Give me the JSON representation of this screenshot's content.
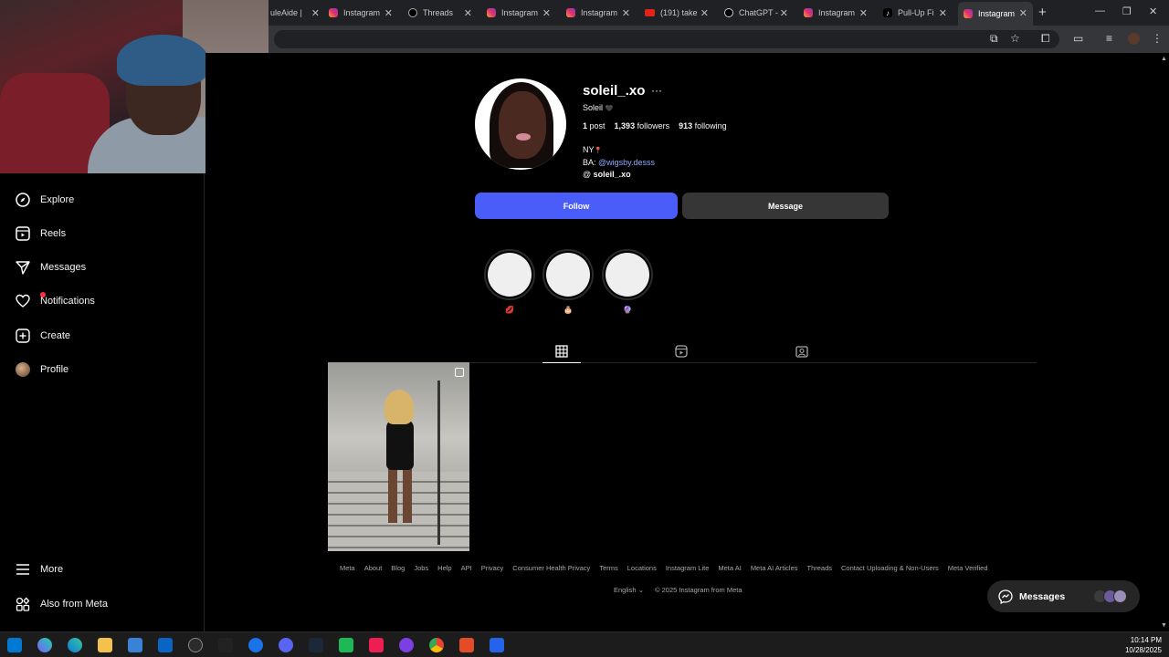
{
  "browser": {
    "tabs": [
      {
        "label": "uleAide |",
        "icon": "generic-icon"
      },
      {
        "label": "Instagram",
        "icon": "instagram-icon"
      },
      {
        "label": "Threads",
        "icon": "threads-icon"
      },
      {
        "label": "Instagram",
        "icon": "instagram-icon"
      },
      {
        "label": "Instagram",
        "icon": "instagram-icon"
      },
      {
        "label": "(191) take",
        "icon": "youtube-icon"
      },
      {
        "label": "ChatGPT -",
        "icon": "chatgpt-icon"
      },
      {
        "label": "Instagram",
        "icon": "instagram-icon"
      },
      {
        "label": "Pull-Up Fi",
        "icon": "tiktok-icon"
      },
      {
        "label": "Instagram",
        "icon": "instagram-icon",
        "active": true
      }
    ],
    "new_tab_symbol": "+",
    "close_symbol": "✕"
  },
  "sidebar": {
    "items": [
      {
        "label": "Explore",
        "icon": "compass-icon"
      },
      {
        "label": "Reels",
        "icon": "reels-icon"
      },
      {
        "label": "Messages",
        "icon": "paper-plane-icon"
      },
      {
        "label": "Notifications",
        "icon": "heart-icon",
        "has_dot": true
      },
      {
        "label": "Create",
        "icon": "plus-square-icon"
      },
      {
        "label": "Profile",
        "icon": "avatar-icon"
      }
    ],
    "bottom_items": [
      {
        "label": "More",
        "icon": "hamburger-icon"
      },
      {
        "label": "Also from Meta",
        "icon": "meta-apps-icon"
      }
    ]
  },
  "profile": {
    "username": "soleil_.xo",
    "options_symbol": "···",
    "full_name": "Soleil",
    "full_name_emoji": "🖤",
    "stats": {
      "posts_count": "1",
      "posts_label": "post",
      "followers_count": "1,393",
      "followers_label": "followers",
      "following_count": "913",
      "following_label": "following"
    },
    "bio": {
      "line1": "NY",
      "line1_emoji": "📍",
      "line2_prefix": "BA:",
      "line2_link": "@wigsby.desss",
      "threads_handle": "soleil_.xo"
    },
    "follow_label": "Follow",
    "message_label": "Message",
    "highlights": [
      {
        "label": "💋"
      },
      {
        "label": "🎂"
      },
      {
        "label": "🔮"
      }
    ],
    "tabs": [
      {
        "name": "posts",
        "icon": "grid-icon",
        "active": true
      },
      {
        "name": "reels",
        "icon": "reels-icon"
      },
      {
        "name": "tagged",
        "icon": "tagged-icon"
      }
    ]
  },
  "footer": {
    "links": [
      "Meta",
      "About",
      "Blog",
      "Jobs",
      "Help",
      "API",
      "Privacy",
      "Consumer Health Privacy",
      "Terms",
      "Locations",
      "Instagram Lite",
      "Meta AI",
      "Meta AI Articles",
      "Threads",
      "Contact Uploading & Non-Users",
      "Meta Verified"
    ],
    "language": "English",
    "copyright": "© 2025 Instagram from Meta"
  },
  "messages_pill": {
    "label": "Messages"
  },
  "taskbar": {
    "time": "10:14 PM",
    "date": "10/28/2025"
  },
  "colors": {
    "follow_button": "#4a5df9",
    "message_button": "#363636",
    "link": "#8fa9ff",
    "background": "#000000"
  }
}
